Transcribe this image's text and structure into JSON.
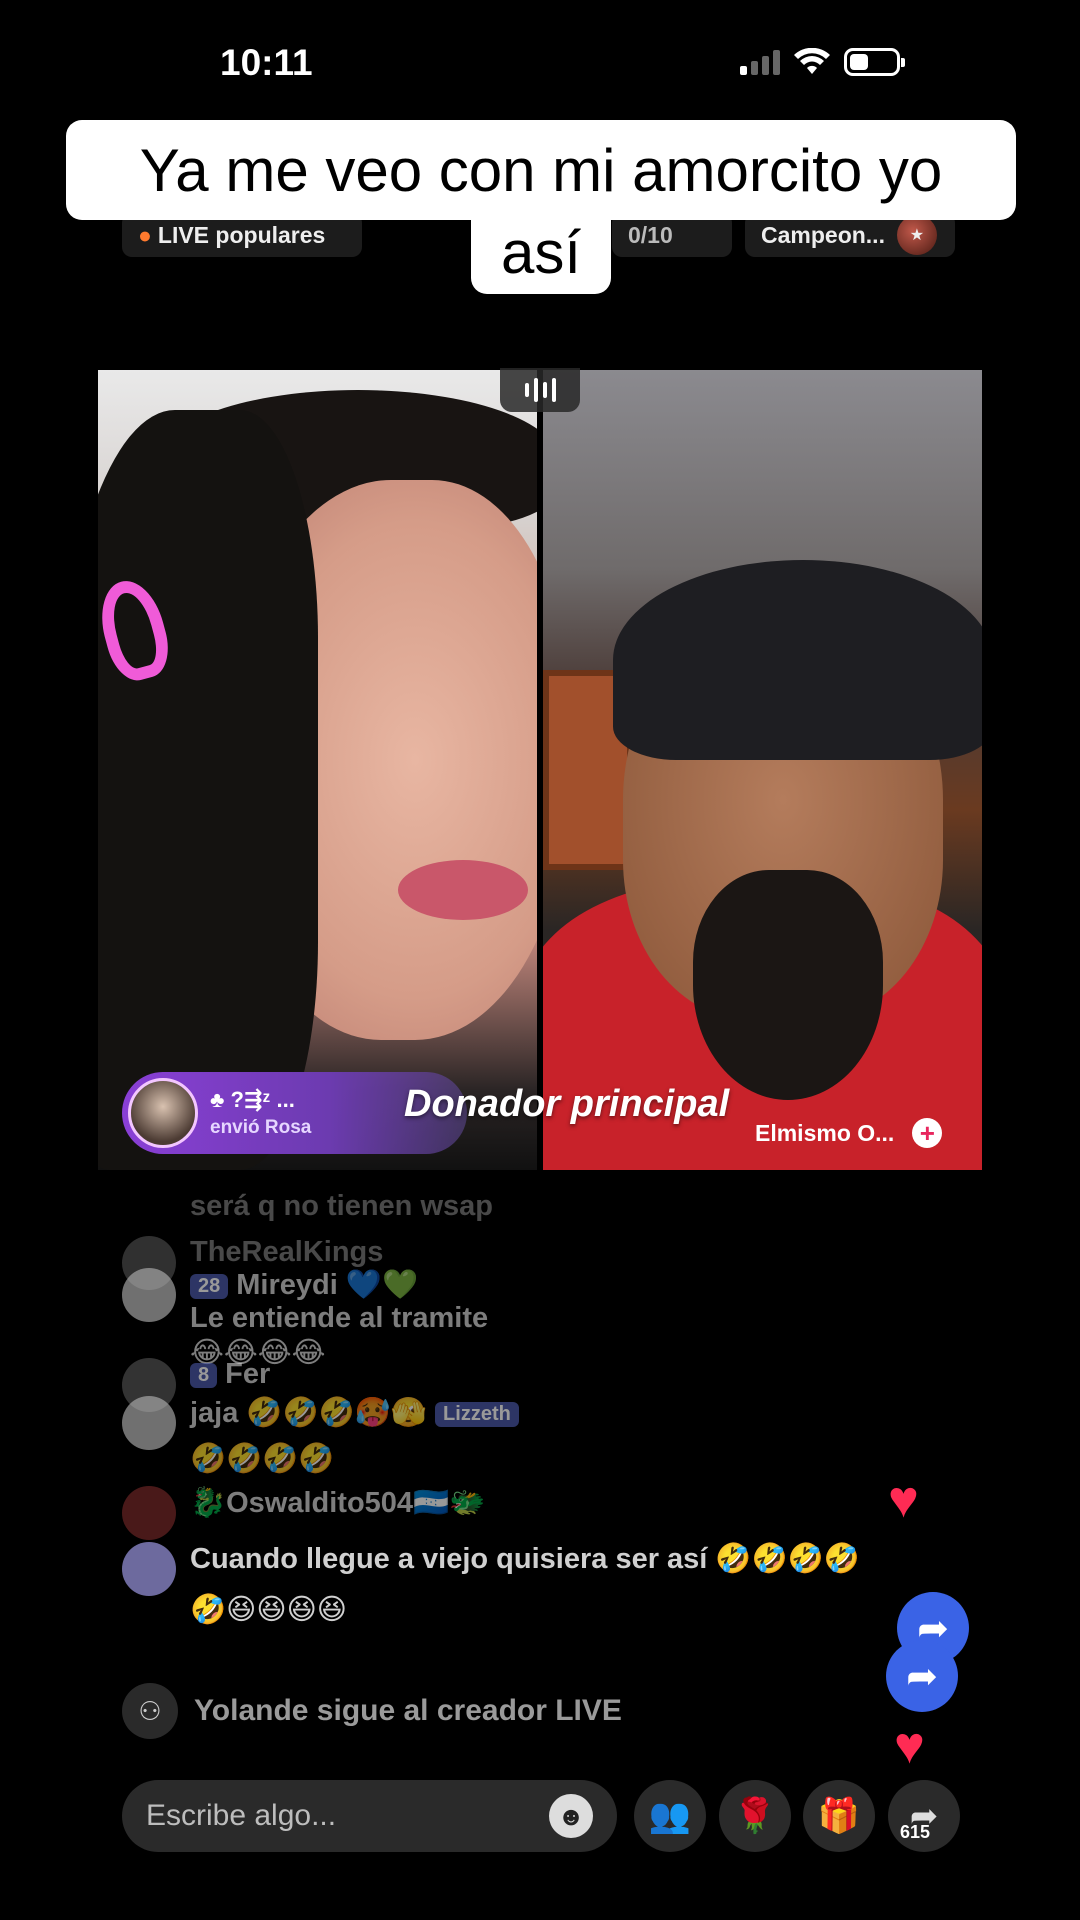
{
  "status_bar": {
    "time": "10:11"
  },
  "caption": {
    "line1": "Ya me veo con mi amorcito yo",
    "line2": "así"
  },
  "top_bar": {
    "live_popular": "LIVE populares",
    "count": "0/10",
    "campeon": "Campeon..."
  },
  "battle": {
    "donor_name": "♣ ?⇶ᶻ ...",
    "donor_sub": "envió Rosa",
    "donor_label": "Donador principal",
    "opponent_name": "Elmismo O..."
  },
  "chat": {
    "m1": "será q no tienen wsap",
    "m2_user": "TheRealKings",
    "m3_badge": "28",
    "m3_user": "Mireydi 💙💚",
    "m4": "Le entiende al tramite",
    "m5": "😂😂😂😂",
    "m6_badge": "8",
    "m6_user": "Fer",
    "m7": "jaja 🤣🤣🤣🥵🫣",
    "m7_user": "Lizzeth",
    "m8": "🤣🤣🤣🤣",
    "m9_user": "🐉Oswaldito504🇭🇳🐲",
    "m10": "Cuando llegue a viejo quisiera ser así 🤣🤣🤣🤣",
    "m11": "🤣😆😆😆😆",
    "system": "Yolande sigue al creador LIVE"
  },
  "bottom_bar": {
    "input_placeholder": "Escribe algo...",
    "share_count": "615"
  },
  "colors": {
    "donor_purple": "#8a3fd6",
    "heart_red": "#ff2b54",
    "share_blue": "#3a63e6"
  },
  "icons": [
    "emoji-icon",
    "guests-icon",
    "rose-icon",
    "gift-icon",
    "share-icon",
    "heart-icon"
  ]
}
